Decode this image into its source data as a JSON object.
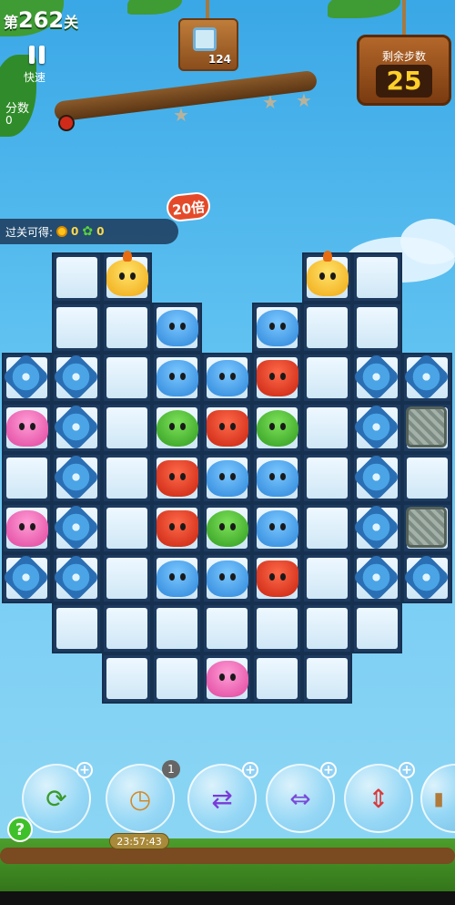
{
  "header": {
    "level_prefix": "第",
    "level_number": "262",
    "level_suffix": "关",
    "fast_label": "快速",
    "score_label": "分数",
    "score_value": "0",
    "goal_count": "124",
    "moves_label": "剩余步数",
    "moves_value": "25"
  },
  "rewards": {
    "label": "过关可得:",
    "value_a": "0",
    "value_b": "0",
    "multiplier": "20倍"
  },
  "board": {
    "rows": [
      [
        "",
        "tile",
        "yellow",
        "",
        "",
        "",
        "yellow",
        "tile",
        ""
      ],
      [
        "",
        "tile",
        "tile",
        "blue",
        "",
        "blue",
        "tile",
        "tile",
        ""
      ],
      [
        "flower",
        "flower",
        "tile",
        "blue",
        "blue",
        "red",
        "tile",
        "flower",
        "flower"
      ],
      [
        "pink",
        "flower",
        "tile",
        "green",
        "red",
        "green",
        "tile",
        "flower",
        "stone"
      ],
      [
        "tile",
        "flower",
        "tile",
        "red",
        "blue",
        "blue",
        "tile",
        "flower",
        "tile"
      ],
      [
        "pink",
        "flower",
        "tile",
        "red",
        "green",
        "blue",
        "tile",
        "flower",
        "stone"
      ],
      [
        "flower",
        "flower",
        "tile",
        "blue",
        "blue",
        "red",
        "tile",
        "flower",
        "flower"
      ],
      [
        "",
        "tile",
        "tile",
        "tile",
        "tile",
        "tile",
        "tile",
        "tile",
        ""
      ],
      [
        "",
        "",
        "tile",
        "tile",
        "pink",
        "tile",
        "tile",
        "",
        ""
      ]
    ]
  },
  "boosters": {
    "timer": "23:57:43",
    "badge_count": "1",
    "help": "?"
  },
  "icons": {
    "pause": "pause-icon",
    "ladybug": "ladybug-icon",
    "star": "star-icon"
  }
}
